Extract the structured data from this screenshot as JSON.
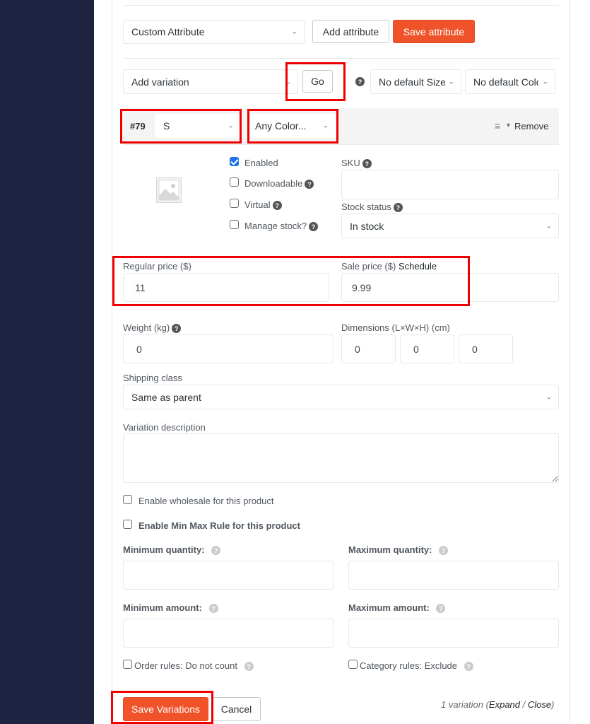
{
  "attribute_bar": {
    "attribute_select": "Custom Attribute",
    "add_attribute": "Add attribute",
    "save_attribute": "Save attribute"
  },
  "variation_bar": {
    "action_select": "Add variation",
    "go": "Go",
    "default_size": "No default Size…",
    "default_color": "No default Colo…"
  },
  "variation": {
    "id": "#79",
    "size": "S",
    "color": "Any Color...",
    "remove": "Remove",
    "enabled_label": "Enabled",
    "enabled": true,
    "downloadable_label": "Downloadable",
    "downloadable": false,
    "virtual_label": "Virtual",
    "virtual": false,
    "manage_stock_label": "Manage stock?",
    "manage_stock": false,
    "sku_label": "SKU",
    "sku_value": "",
    "stock_status_label": "Stock status",
    "stock_status": "In stock",
    "regular_price_label": "Regular price ($)",
    "regular_price": "11",
    "sale_price_label": "Sale price ($)",
    "schedule_link": "Schedule",
    "sale_price": "9.99",
    "weight_label": "Weight (kg)",
    "weight": "0",
    "dimensions_label": "Dimensions (L×W×H) (cm)",
    "length": "0",
    "width": "0",
    "height": "0",
    "shipping_class_label": "Shipping class",
    "shipping_class": "Same as parent",
    "description_label": "Variation description",
    "description": ""
  },
  "wholesale": {
    "enable_wholesale_label": "Enable wholesale for this product",
    "enable_minmax_label": "Enable Min Max Rule for this product",
    "min_qty_label": "Minimum quantity:",
    "max_qty_label": "Maximum quantity:",
    "min_amount_label": "Minimum amount:",
    "max_amount_label": "Maximum amount:",
    "order_rules_label": "Order rules: Do not count",
    "category_rules_label": "Category rules: Exclude"
  },
  "footer": {
    "save_variations": "Save Variations",
    "cancel": "Cancel",
    "count_text": "1 variation (",
    "expand": "Expand",
    "sep": " / ",
    "close": "Close",
    "end": ")"
  }
}
